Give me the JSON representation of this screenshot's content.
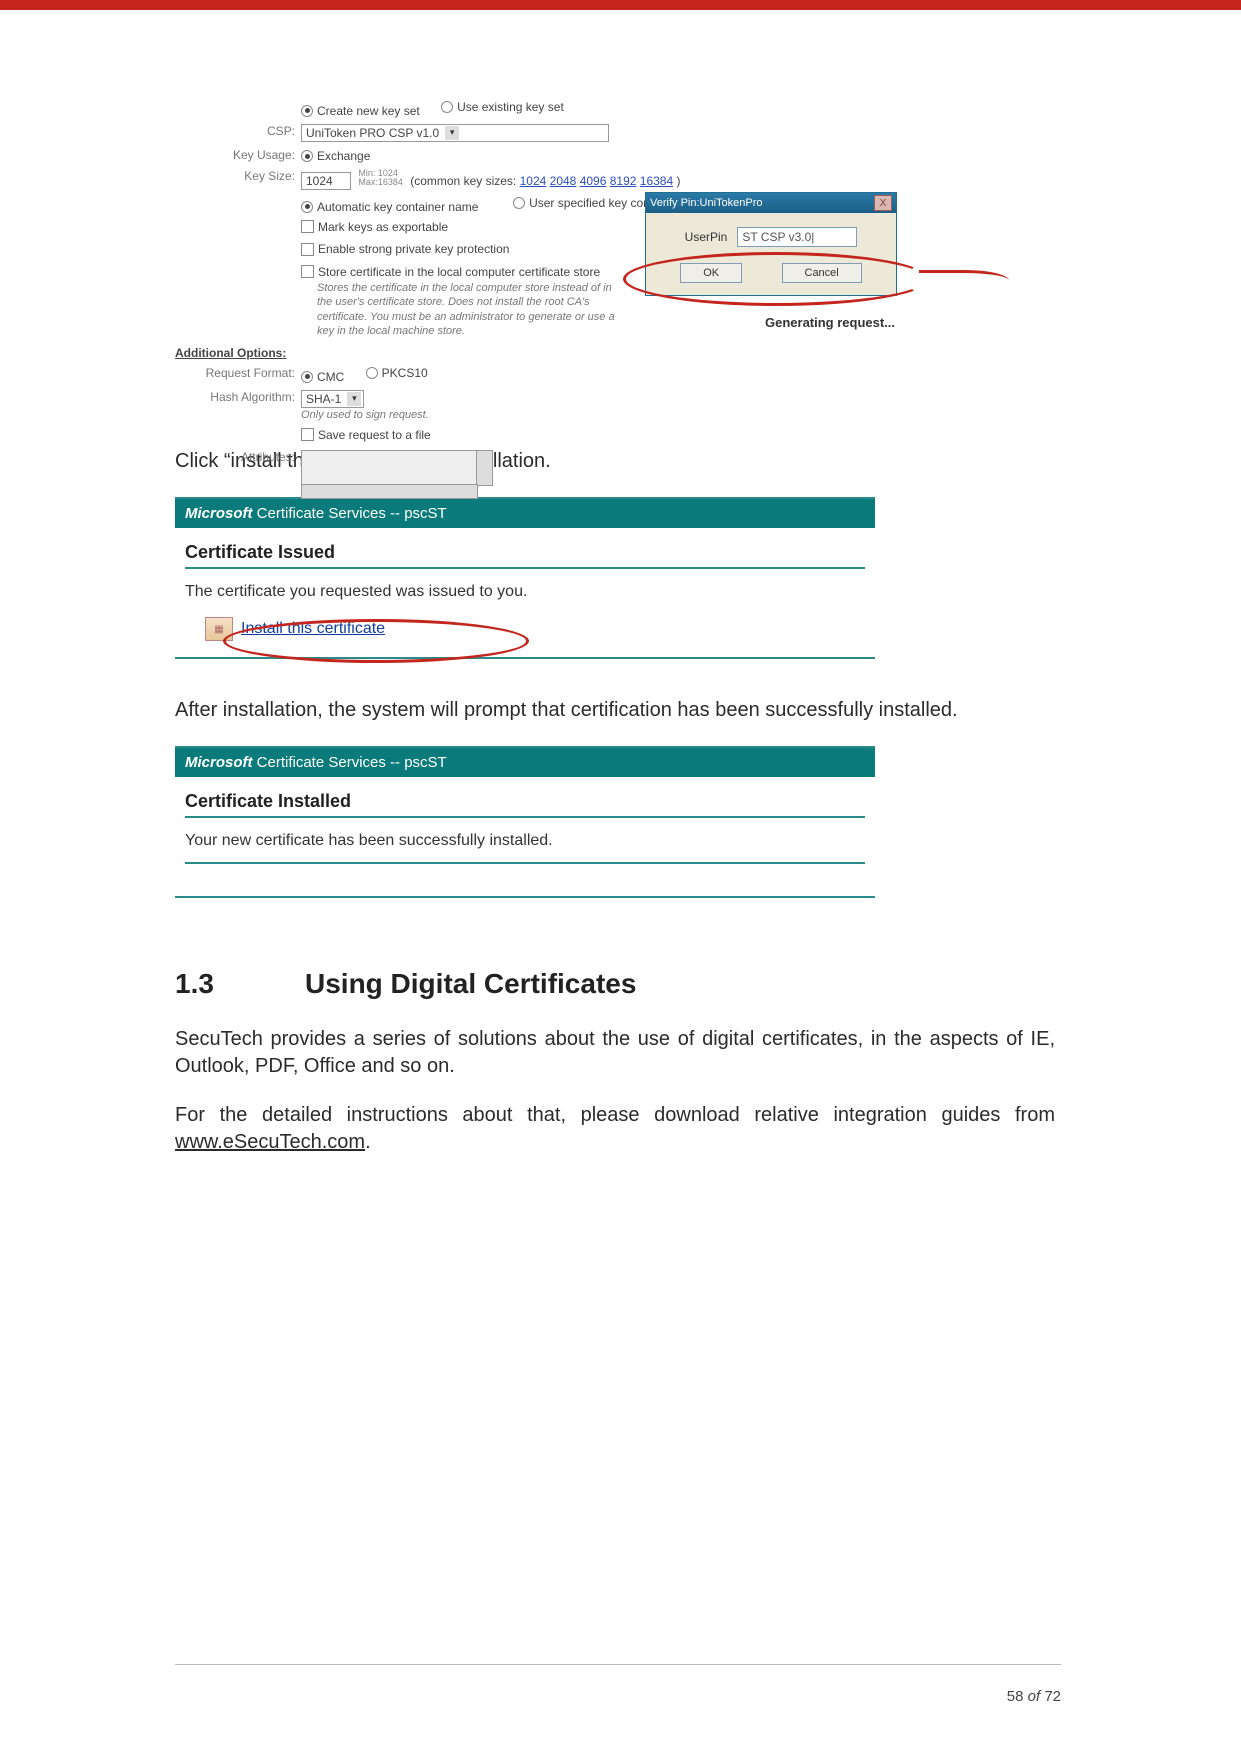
{
  "form": {
    "radio_create": "Create new key set",
    "radio_use": "Use existing key set",
    "csp_label": "CSP:",
    "csp_value": "UniToken PRO CSP v1.0",
    "keyusage_label": "Key Usage:",
    "keyusage_value": "Exchange",
    "keysize_label": "Key Size:",
    "keysize_value": "1024",
    "keysize_minmax": "Min: 1024\nMax:16384",
    "keysize_common_prefix": "(common key sizes:",
    "keysize_common_links": [
      "1024",
      "2048",
      "4096",
      "8192",
      "16384"
    ],
    "radio_auto": "Automatic key container name",
    "radio_user": "User specified key container n",
    "chk_mark": "Mark keys as exportable",
    "chk_strong": "Enable strong private key protection",
    "chk_store": "Store certificate in the local computer certificate store",
    "store_note": "Stores the certificate in the local computer store instead of in the user's certificate store. Does not install the root CA's certificate. You must be an administrator to generate or use a key in the local machine store.",
    "addopt": "Additional Options:",
    "reqfmt_label": "Request Format:",
    "reqfmt_cmc": "CMC",
    "reqfmt_pkcs": "PKCS10",
    "hash_label": "Hash Algorithm:",
    "hash_value": "SHA-1",
    "hash_note": "Only used to sign request.",
    "chk_save": "Save request to a file",
    "attr_label": "Attributes:"
  },
  "dialog": {
    "title": "Verify Pin:UniTokenPro",
    "close": "X",
    "pin_label": "UserPin",
    "pin_value": "ST CSP v3.0|",
    "ok": "OK",
    "cancel": "Cancel"
  },
  "genreq": "Generating request...",
  "para1_prefix": "Click “",
  "para1_link": "install this certificate",
  "para1_suffix": "”  for installation.",
  "msbox1": {
    "brand": "Microsoft",
    "svc": " Certificate Services  --  pscST",
    "heading": "Certificate Issued",
    "text": "The certificate you requested was issued to you.",
    "link": "Install this certificate"
  },
  "para2": "After installation, the system will prompt that certification has been successfully installed.",
  "msbox2": {
    "brand": "Microsoft",
    "svc": " Certificate Services  --  pscST",
    "heading": "Certificate Installed",
    "text": "Your new certificate has been successfully installed."
  },
  "section": {
    "num": "1.3",
    "title": "Using Digital Certificates"
  },
  "body1": "SecuTech provides a series of solutions about the use of digital certificates, in the aspects of IE, Outlook, PDF, Office and so on.",
  "body2_prefix": "For the detailed instructions about that, please download relative integration guides from ",
  "body2_link": "www.eSecuTech.com",
  "body2_suffix": ".",
  "footer": {
    "page": "58",
    "of": "of",
    "total": "72"
  }
}
